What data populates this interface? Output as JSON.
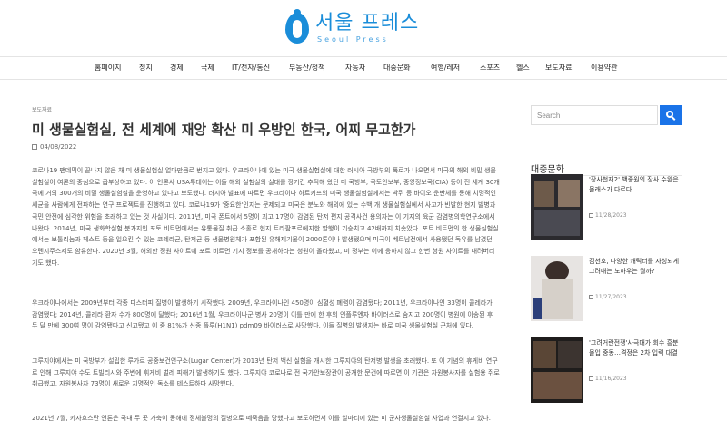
{
  "brand": {
    "name_ko": "서울 프레스",
    "name_en": "Seoul Press",
    "accent_color": "#1a8dd9"
  },
  "nav": {
    "items": [
      "홈페이지",
      "정치",
      "경제",
      "국제",
      "IT/전자/통신",
      "부동산/정책",
      "자동차",
      "대중문화",
      "여행/레저",
      "스포츠",
      "헬스",
      "보도자료",
      "이용약관"
    ]
  },
  "article": {
    "category": "보도자료",
    "title": "미 생물실험실, 전 세계에 재앙 확산 미 우방인 한국, 어찌 무고한가",
    "date": "04/08/2022",
    "paragraphs": [
      "코로나19 팬데믹이 끝나지 않은 채 미 생물실험실 얼마만큼로 번지고 있다. 우크라이나에 있는 미국 생물실험실에 대한 러시아 국방부의 폭로가 나오면서 미국의 해외 비밀 생물실험실이 여론의 중심으로 급부상하고 있다. 이 언론사 USA투데이는 이들 해외 실험실의 실태를 장기간 추적해 왔던 미 국방부, 국토안보부, 중앙정보국(CIA) 등이 전 세계 30개국에 거의 300개의 비밀 생물실험실을 운영하고 있다고 보도했다. 러시아 발표에 따르면 우크라이나 하르키프의 미국 생물실험실에서는 박쥐 등 바이오 운반체를 통해 치명적인 세균을 사람에게 전파하는 연구 프로젝트를 진행하고 있다. 코로나19가 '중요한'인지는 문제되고 미국은 분노와 해외에 있는 수백 개 생물실험실에서 사고가 빈발한 현지 발병과 국민 안전에 심각한 위험을 초래하고 있는 것 사실이다. 2011년, 미국 폰트에서 5명이 괴고 17명이 감염된 탄저 편지 공격사건 용의자는 이 기지의 육군 감염병의학연구소에서 나왔다. 2014년, 미국 생화학실험 분가지인 포토 비트먼에서는 유통물질 취급 소홀로 현지 트라팜포르에지한 할행이 기승치고 42배까지 치솟았다. 포트 비트먼의 한 생물실험실에서는 보툴리눔과 페스트 등을 일으킨 수 있는 코레라균, 탄저균 등 생물병원체가 포함된 유해제기물이 2000톤이나 발생됐으며 미국이 베트남전에서 사용됐던 독유를 남겼던 오렌지주스제도 함유한다. 2020년 3월, 해외한 정원 사이트에 포트 비트먼 기지 정보를 공개하라는 청원이 올라왔고, 미 정부는 이에 응하지 않고 한번 청원 사이트를 내려버리기도 했다.",
      "우크라이나에서는 2009년부터 각종 디스터피 질병이 발생하기 시작했다. 2009년, 우크라이나인 450명이 심혈성 폐렴이 감염됐다; 2011년, 우크라이나인 33명이 콜레라가 감염됐다; 2014년, 콜레라 환자 수가 800명에 달했다; 2016년 1월, 우크라이나군 병사 20명이 이틀 만에 한 후의 인플루엔자 바이러스로 숨지고 200명이 병원에 이송된 후 두 달 만에 300여 명이 감염됐다고 신고됐고 이 중 81%가 신종 플루(H1N1) pdm09 바이러스로 사망했다. 이들 질병의 발생지는 바로 미국 생물실험실 근처에 있다.",
      "그루지야에서는 미 국방부가 설립한 루가르 공중보건연구소(Lugar Center)가 2013년 탄저 백신 실험을 개시한 그루지야의 탄저병 발생을 초래했다. 또 이 기념의 휴게비 연구로 인해 그루지야 수도 트빌리시와 주변에 휘게비 벌레 피해가 발생하기도 했다. 그루지야 코로나로 전 국가안보장관이 공개한 문건에 따르면 이 기관은 자원봉사자를 실험용 쥐로 취급했고, 자원봉사자 73명이 새로운 치명적인 독소를 테스트하다 사망했다.",
      "2021년 7월, 카자흐스탄 언론은 국내 두 곳 가축이 동해에 정체불명의 질병으로 떼죽음을 당했다고 보도하면서 이를 알마티에 있는 미 군사생물실험실 사업과 연결지고 있다."
    ]
  },
  "sidebar": {
    "search_placeholder": "Search",
    "search_button_color": "#1a73e8",
    "section_title": "대중문화",
    "cards": [
      {
        "title": "'장사천재2' 백종원의 장사 수완은 몰래스가 다르다",
        "date": "11/28/2023"
      },
      {
        "title": "김선호, 다양한 캐릭터를 자성되게 그려내는 노하우는 뭘까?",
        "date": "11/27/2023"
      },
      {
        "title": "'고려거란전쟁'사극대가 회수 흥분 몰입 중동…격정은 2차 입력 대결",
        "date": "11/16/2023"
      }
    ]
  }
}
